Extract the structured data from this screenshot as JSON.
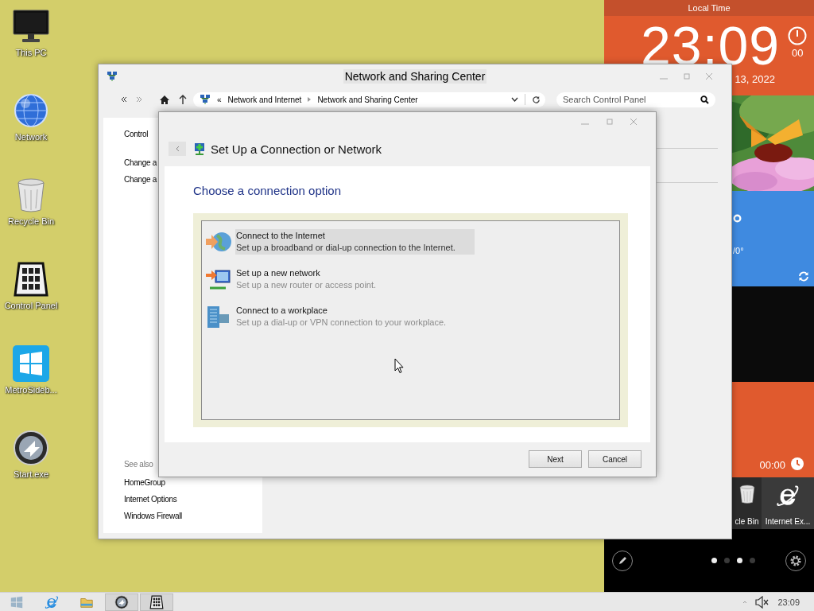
{
  "desktop_icons": [
    {
      "label": "This PC",
      "kind": "monitor"
    },
    {
      "label": "Network",
      "kind": "globe"
    },
    {
      "label": "Recycle Bin",
      "kind": "bin"
    },
    {
      "label": "Control Panel",
      "kind": "keypad"
    },
    {
      "label": "MetroSideb...",
      "kind": "tiles"
    },
    {
      "label": "Start.exe",
      "kind": "orb"
    }
  ],
  "main_window": {
    "title": "Network and Sharing Center",
    "address": {
      "overflow": "«",
      "crumbs": [
        "Network and Internet",
        "Network and Sharing Center"
      ]
    },
    "search": {
      "placeholder": "Search Control Panel"
    },
    "left_pane": {
      "links": [
        "Control",
        "Change a",
        "Change a"
      ],
      "see_also_heading": "See also",
      "see_also": [
        "HomeGroup",
        "Internet Options",
        "Windows Firewall"
      ]
    }
  },
  "dialog": {
    "title": "Set Up a Connection or Network",
    "heading": "Choose a connection option",
    "options": [
      {
        "kind": "internet",
        "title": "Connect to the Internet",
        "description": "Set up a broadband or dial-up connection to the Internet.",
        "selected": true
      },
      {
        "kind": "network",
        "title": "Set up a new network",
        "description": "Set up a new router or access point.",
        "selected": false
      },
      {
        "kind": "workplace",
        "title": "Connect to a workplace",
        "description": "Set up a dial-up or VPN connection to your workplace.",
        "selected": false
      }
    ],
    "buttons": [
      "Next",
      "Cancel"
    ]
  },
  "sidebar": {
    "header": "Local Time",
    "time": "23:09",
    "seconds": "00",
    "date": "13, 2022",
    "weather_range": "/0°",
    "timer": "00:00",
    "tiles": [
      {
        "label": "cle Bin",
        "kind": "bin"
      },
      {
        "label": "Internet Ex...",
        "kind": "ie"
      }
    ],
    "pages": [
      {
        "on": true
      },
      {
        "on": false
      },
      {
        "on": true
      },
      {
        "on": false
      }
    ]
  },
  "taskbar": {
    "items": [
      {
        "kind": "start",
        "running": false
      },
      {
        "kind": "ie",
        "running": false
      },
      {
        "kind": "folder",
        "running": false
      },
      {
        "kind": "orb",
        "running": true
      },
      {
        "kind": "keypad",
        "running": true
      }
    ],
    "clock": "23:09"
  }
}
